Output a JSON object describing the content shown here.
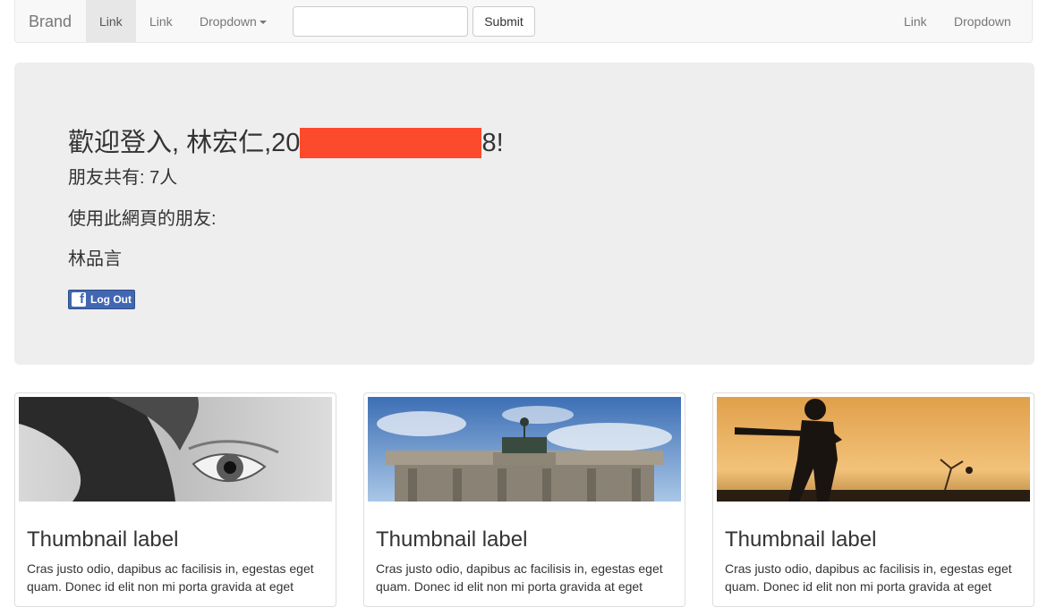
{
  "navbar": {
    "brand": "Brand",
    "link_active": "Link",
    "link2": "Link",
    "dropdown_left": "Dropdown",
    "search_placeholder": "",
    "submit_label": "Submit",
    "link_right": "Link",
    "dropdown_right": "Dropdown"
  },
  "jumbotron": {
    "welcome_prefix": "歡迎登入, 林宏仁,20",
    "welcome_suffix": "8!",
    "friend_count": "朋友共有: 7人",
    "using_friends_label": "使用此網頁的朋友:",
    "friend_name": "林品言",
    "logout_label": "Log Out"
  },
  "thumbnails": [
    {
      "label": "Thumbnail label",
      "text": "Cras justo odio, dapibus ac facilisis in, egestas eget quam. Donec id elit non mi porta gravida at eget"
    },
    {
      "label": "Thumbnail label",
      "text": "Cras justo odio, dapibus ac facilisis in, egestas eget quam. Donec id elit non mi porta gravida at eget"
    },
    {
      "label": "Thumbnail label",
      "text": "Cras justo odio, dapibus ac facilisis in, egestas eget quam. Donec id elit non mi porta gravida at eget"
    }
  ],
  "colors": {
    "navbar_bg": "#f8f8f8",
    "jumbotron_bg": "#eeeeee",
    "redaction": "#fc4a2c",
    "facebook_blue": "#4267b2"
  }
}
